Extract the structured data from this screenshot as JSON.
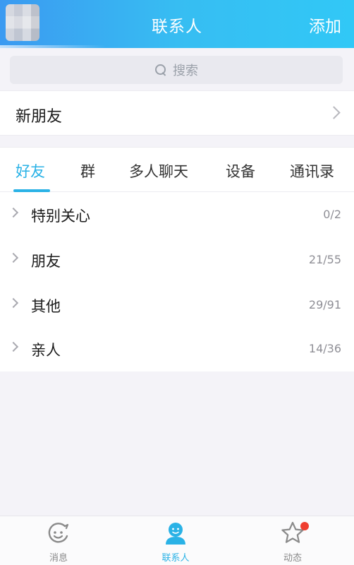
{
  "header": {
    "title": "联系人",
    "add_label": "添加"
  },
  "search": {
    "placeholder": "搜索"
  },
  "new_friend": {
    "label": "新朋友"
  },
  "tabs": [
    {
      "label": "好友",
      "active": true
    },
    {
      "label": "群",
      "active": false
    },
    {
      "label": "多人聊天",
      "active": false
    },
    {
      "label": "设备",
      "active": false
    },
    {
      "label": "通讯录",
      "active": false
    }
  ],
  "groups": [
    {
      "name": "特别关心",
      "count": "0/2"
    },
    {
      "name": "朋友",
      "count": "21/55"
    },
    {
      "name": "其他",
      "count": "29/91"
    },
    {
      "name": "亲人",
      "count": "14/36"
    }
  ],
  "bottom_nav": [
    {
      "label": "消息",
      "icon": "message-icon",
      "active": false
    },
    {
      "label": "联系人",
      "icon": "contacts-icon",
      "active": true
    },
    {
      "label": "动态",
      "icon": "star-icon",
      "active": false,
      "badge": true
    }
  ],
  "colors": {
    "accent": "#2ab2e6",
    "header_start": "#3b9af1",
    "header_end": "#31c8f6",
    "badge": "#ef3e2f"
  }
}
